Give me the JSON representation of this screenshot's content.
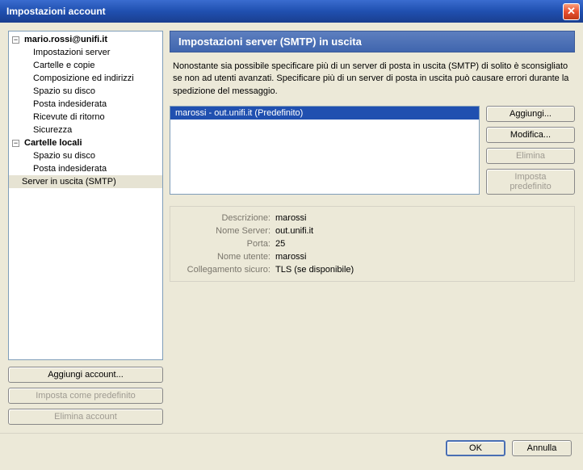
{
  "window": {
    "title": "Impostazioni account"
  },
  "tree": {
    "account_root": "mario.rossi@unifi.it",
    "account_children": [
      "Impostazioni server",
      "Cartelle e copie",
      "Composizione ed indirizzi",
      "Spazio su disco",
      "Posta indesiderata",
      "Ricevute di ritorno",
      "Sicurezza"
    ],
    "local_root": "Cartelle locali",
    "local_children": [
      "Spazio su disco",
      "Posta indesiderata"
    ],
    "smtp_item": "Server in uscita (SMTP)"
  },
  "left_buttons": {
    "add": "Aggiungi account...",
    "set_default": "Imposta come predefinito",
    "remove": "Elimina account"
  },
  "section": {
    "header": "Impostazioni server (SMTP) in uscita",
    "description": "Nonostante sia possibile specificare più di un server di posta in uscita (SMTP) di solito è sconsigliato se non ad utenti avanzati. Specificare più di un server di posta in uscita può causare errori durante la spedizione del messaggio."
  },
  "servers": {
    "items": [
      "marossi - out.unifi.it (Predefinito)"
    ],
    "buttons": {
      "add": "Aggiungi...",
      "edit": "Modifica...",
      "remove": "Elimina",
      "set_default": "Imposta predefinito"
    }
  },
  "details": {
    "labels": {
      "description": "Descrizione:",
      "server": "Nome Server:",
      "port": "Porta:",
      "user": "Nome utente:",
      "secure": "Collegamento sicuro:"
    },
    "values": {
      "description": "marossi",
      "server": "out.unifi.it",
      "port": "25",
      "user": "marossi",
      "secure": "TLS (se disponibile)"
    }
  },
  "bottom": {
    "ok": "OK",
    "cancel": "Annulla"
  }
}
